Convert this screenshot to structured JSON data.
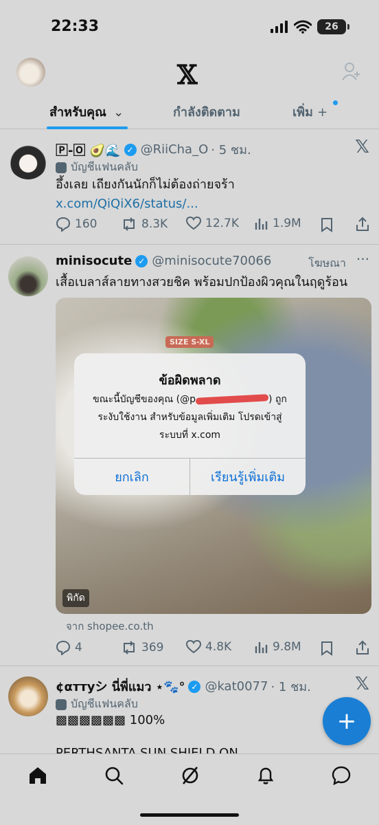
{
  "status": {
    "time": "22:33",
    "battery": "26"
  },
  "header": {
    "logo": "𝕏"
  },
  "tabs": [
    {
      "label": "สำหรับคุณ"
    },
    {
      "label": "กำลังติดตาม"
    },
    {
      "label": "เพิ่ม"
    }
  ],
  "posts": [
    {
      "name": "🄿-🄾 🥑🌊",
      "handle": "@RiiCha_O",
      "time": "· 5 ชม.",
      "badge": "บัญชีแฟนคลับ",
      "text": "อึ้งเลย เถียงกันนักก็ไม่ต้องถ่ายจร้า ",
      "link": "x.com/QiQiX6/status/...",
      "stats": {
        "replies": "160",
        "reposts": "8.3K",
        "likes": "12.7K",
        "views": "1.9M"
      }
    },
    {
      "name": "minisocute",
      "handle": "@minisocute70066",
      "ad_label": "โฆษณา",
      "text": "เสื้อเบลาส์ลายทางสวยชิค พร้อมปกป้องผิวคุณในฤดูร้อน",
      "media_badge": "SIZE S-XL",
      "pin_label": "พิกัด",
      "source": "จาก shopee.co.th",
      "stats": {
        "replies": "4",
        "reposts": "369",
        "likes": "4.8K",
        "views": "9.8M"
      }
    },
    {
      "name": "¢αттуシ นี่พี่แมว ⋆🐾°",
      "handle": "@kat0077",
      "time": "· 1 ชม.",
      "badge": "บัญชีแฟนคลับ",
      "text": "▩▩▩▩▩▩ 100%",
      "text2": "PERTHSANTA SUN SHIELD ON"
    }
  ],
  "dialog": {
    "title": "ข้อผิดพลาด",
    "msg_before": "ขณะนี้บัญชีของคุณ (@p",
    "msg_after": ") ถูกระงับใช้งาน สำหรับข้อมูลเพิ่มเติม โปรดเข้าสู่ระบบที่ x.com",
    "cancel": "ยกเลิก",
    "learn_more": "เรียนรู้เพิ่มเติม"
  },
  "fab": "+",
  "colors": {
    "accent": "#1d9bf0",
    "link": "#1d6fa5",
    "dialog_button": "#0a6fd6"
  }
}
